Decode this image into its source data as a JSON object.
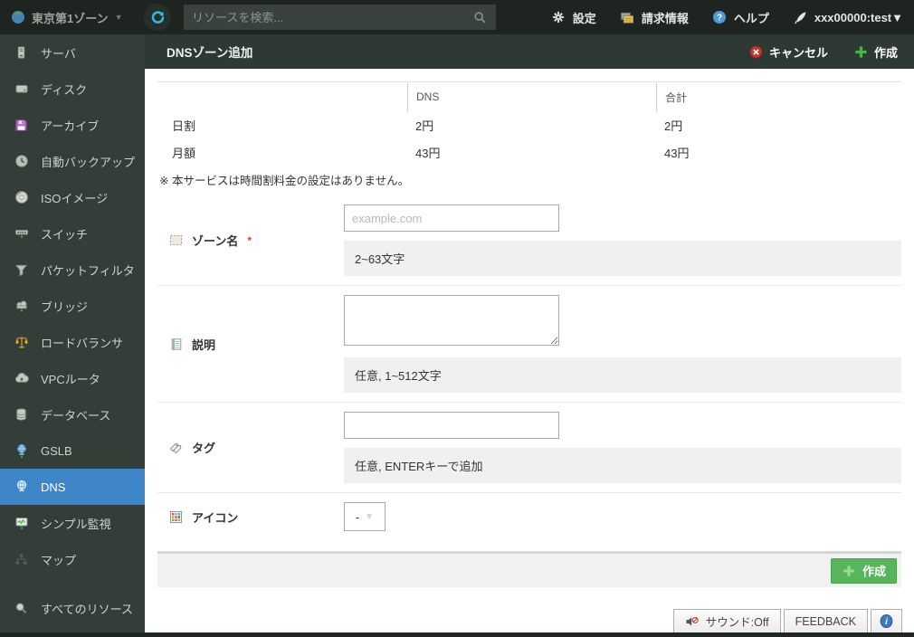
{
  "topbar": {
    "zone_selector": {
      "label": "東京第1ゾーン",
      "caret": "▼"
    },
    "search": {
      "placeholder": "リソースを検索..."
    },
    "menu": {
      "settings": "設定",
      "billing": "請求情報",
      "help": "ヘルプ",
      "account": "xxx00000:test▼"
    }
  },
  "sidebar": {
    "items": [
      {
        "label": "サーバ",
        "icon": "server-icon",
        "active": false
      },
      {
        "label": "ディスク",
        "icon": "disk-icon",
        "active": false
      },
      {
        "label": "アーカイブ",
        "icon": "archive-icon",
        "active": false
      },
      {
        "label": "自動バックアップ",
        "icon": "auto-backup-icon",
        "active": false
      },
      {
        "label": "ISOイメージ",
        "icon": "iso-image-icon",
        "active": false
      },
      {
        "label": "スイッチ",
        "icon": "switch-icon",
        "active": false
      },
      {
        "label": "パケットフィルタ",
        "icon": "packet-filter-icon",
        "active": false
      },
      {
        "label": "ブリッジ",
        "icon": "bridge-icon",
        "active": false
      },
      {
        "label": "ロードバランサ",
        "icon": "load-balancer-icon",
        "active": false
      },
      {
        "label": "VPCルータ",
        "icon": "vpc-router-icon",
        "active": false
      },
      {
        "label": "データベース",
        "icon": "database-icon",
        "active": false
      },
      {
        "label": "GSLB",
        "icon": "gslb-icon",
        "active": false
      },
      {
        "label": "DNS",
        "icon": "dns-icon",
        "active": true
      },
      {
        "label": "シンプル監視",
        "icon": "simple-monitor-icon",
        "active": false
      },
      {
        "label": "マップ",
        "icon": "map-icon",
        "active": false
      },
      {
        "label": "すべてのリソース",
        "icon": "all-resources-icon",
        "active": false
      }
    ]
  },
  "header": {
    "title": "DNSゾーン追加",
    "cancel_label": "キャンセル",
    "create_label": "作成"
  },
  "pricing": {
    "columns": {
      "col1": "DNS",
      "col2": "合計"
    },
    "rows": [
      {
        "label": "日割",
        "dns": "2円",
        "total": "2円"
      },
      {
        "label": "月額",
        "dns": "43円",
        "total": "43円"
      }
    ],
    "note": "※ 本サービスは時間割料金の設定はありません。"
  },
  "form": {
    "zone_name": {
      "label": "ゾーン名",
      "required_mark": "*",
      "placeholder": "example.com",
      "hint": "2~63文字"
    },
    "description": {
      "label": "説明",
      "hint": "任意, 1~512文字"
    },
    "tags": {
      "label": "タグ",
      "hint": "任意, ENTERキーで追加"
    },
    "icon": {
      "label": "アイコン",
      "value": "-",
      "caret": "▼"
    }
  },
  "actions": {
    "create_label": "作成"
  },
  "footer": {
    "sound_label": "サウンド:Off",
    "feedback_label": "FEEDBACK"
  },
  "colors": {
    "sidebar_active_blue": "#3e86c8",
    "create_green": "#58b55c",
    "cancel_red": "#c2392f",
    "help_blue": "#4f9bd8",
    "refresh_cyan": "#35b9da"
  }
}
